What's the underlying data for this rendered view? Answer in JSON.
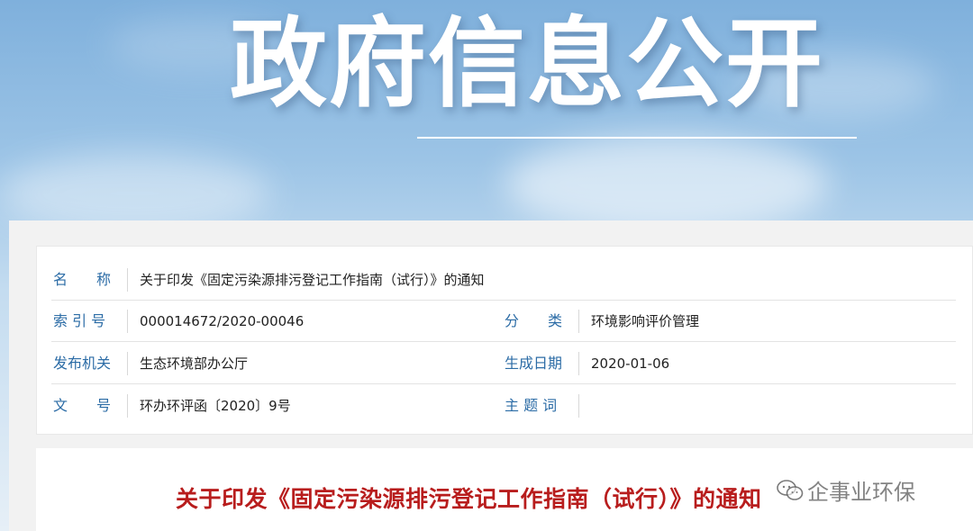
{
  "banner": {
    "title": "政府信息公开"
  },
  "info": {
    "name_label": "名　　称",
    "name_value": "关于印发《固定污染源排污登记工作指南（试行）》的通知",
    "index_label": "索 引 号",
    "index_value": "000014672/2020-00046",
    "category_label": "分　　类",
    "category_value": "环境影响评价管理",
    "publisher_label": "发布机关",
    "publisher_value": "生态环境部办公厅",
    "date_label": "生成日期",
    "date_value": "2020-01-06",
    "docno_label": "文　　号",
    "docno_value": "环办环评函〔2020〕9号",
    "keywords_label": "主 题 词",
    "keywords_value": ""
  },
  "document": {
    "title": "关于印发《固定污染源排污登记工作指南（试行）》的通知"
  },
  "watermark": {
    "text": "企事业环保",
    "icon": "wechat-icon"
  }
}
